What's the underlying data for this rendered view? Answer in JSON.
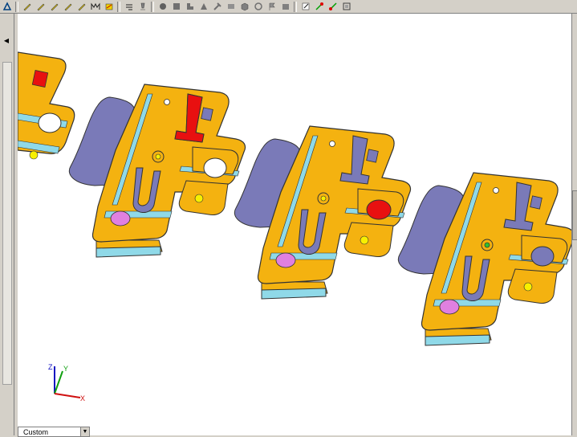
{
  "toolbar": {
    "left_icon": "sketch-icon",
    "group1_icons": [
      "pencil-yellow-icon",
      "pencil-yellow-icon",
      "pencil-yellow-icon",
      "pencil-yellow-icon",
      "pencil-yellow-icon",
      "measure-icon",
      "dimension-icon"
    ],
    "group2_icons": [
      "align-icon",
      "filter-icon"
    ],
    "group3_icons": [
      "circle-icon",
      "square-icon",
      "corner-icon",
      "shape-icon",
      "tool-icon",
      "view-icon",
      "cube-icon",
      "rotate-icon",
      "flag-icon",
      "box-icon"
    ],
    "group4_icons": [
      "edit-icon",
      "snap-icon",
      "snap-icon",
      "frame-icon"
    ]
  },
  "axis_triad": {
    "x": "X",
    "y": "Y",
    "z": "Z"
  },
  "view_select": {
    "value": "Custom"
  },
  "colors": {
    "part": "#f4b210",
    "channel": "#8fd9e8",
    "blade": "#7a7ab8",
    "red": "#e81010",
    "pink": "#e080e0",
    "yellow_dot": "#f8f000",
    "green_dot": "#30c030"
  }
}
